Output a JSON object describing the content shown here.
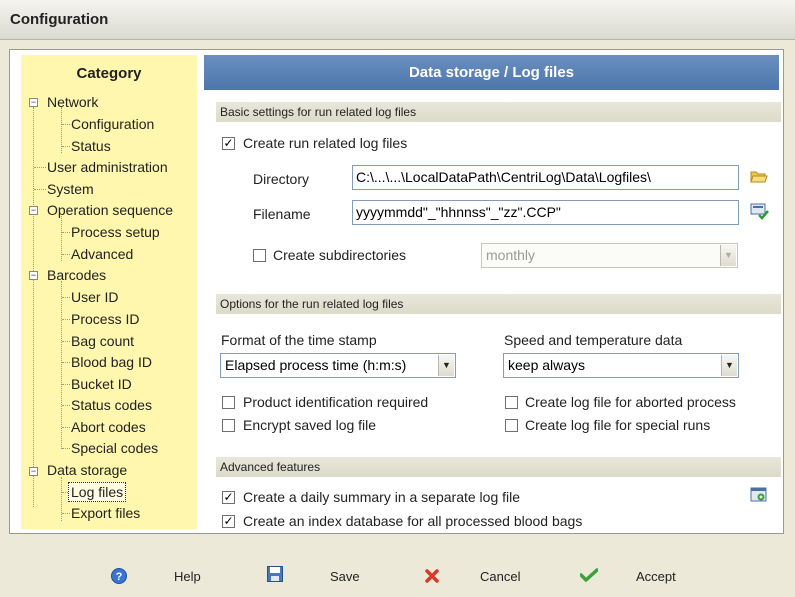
{
  "window": {
    "title": "Configuration"
  },
  "sidebar": {
    "heading": "Category",
    "items": [
      {
        "label": "Network",
        "expander": "⊟"
      },
      {
        "label": "Configuration"
      },
      {
        "label": "Status"
      },
      {
        "label": "User administration"
      },
      {
        "label": "System"
      },
      {
        "label": "Operation sequence",
        "expander": "⊟"
      },
      {
        "label": "Process setup"
      },
      {
        "label": "Advanced"
      },
      {
        "label": "Barcodes",
        "expander": "⊟"
      },
      {
        "label": "User ID"
      },
      {
        "label": "Process ID"
      },
      {
        "label": "Bag count"
      },
      {
        "label": "Blood bag ID"
      },
      {
        "label": "Bucket ID"
      },
      {
        "label": "Status codes"
      },
      {
        "label": "Abort codes"
      },
      {
        "label": "Special codes"
      },
      {
        "label": "Data storage",
        "expander": "⊟"
      },
      {
        "label": "Log files",
        "selected": true
      },
      {
        "label": "Export files"
      }
    ]
  },
  "main": {
    "title": "Data storage / Log files",
    "basic": {
      "section_title": "Basic settings for run related log files",
      "create_run_logs": {
        "label": "Create run related log files",
        "checked": true,
        "mark": "✓"
      },
      "directory": {
        "label": "Directory",
        "value": "C:\\...\\...\\LocalDataPath\\CentriLog\\Data\\Logfiles\\"
      },
      "filename": {
        "label": "Filename",
        "value": "yyyymmdd\"_\"hhnnss\"_\"zz\".CCP\""
      },
      "subdirs": {
        "label": "Create subdirectories",
        "checked": false,
        "mark": "",
        "option": "monthly"
      }
    },
    "options": {
      "section_title": "Options for the run related log files",
      "timestamp": {
        "label": "Format of the time stamp",
        "value": "Elapsed process time (h:m:s)"
      },
      "speed_temp": {
        "label": "Speed and temperature data",
        "value": "keep always"
      },
      "product_id": {
        "label": "Product identification required",
        "checked": false,
        "mark": ""
      },
      "encrypt": {
        "label": "Encrypt saved log file",
        "checked": false,
        "mark": ""
      },
      "aborted": {
        "label": "Create log file for aborted process",
        "checked": false,
        "mark": ""
      },
      "special": {
        "label": "Create log file for special runs",
        "checked": false,
        "mark": ""
      }
    },
    "advanced": {
      "section_title": "Advanced features",
      "daily_summary": {
        "label": "Create a daily summary in a separate log file",
        "checked": true,
        "mark": "✓"
      },
      "index_db": {
        "label": "Create an index database for all processed blood bags",
        "checked": true,
        "mark": "✓"
      }
    }
  },
  "buttons": {
    "help": "Help",
    "save": "Save",
    "cancel": "Cancel",
    "accept": "Accept"
  },
  "icons": {
    "folder": "folder-open-icon",
    "filename_check": "filename-check-icon",
    "advanced_settings": "advanced-settings-icon",
    "help": "help-icon",
    "save": "save-icon",
    "cancel": "cancel-icon",
    "accept": "accept-icon"
  }
}
